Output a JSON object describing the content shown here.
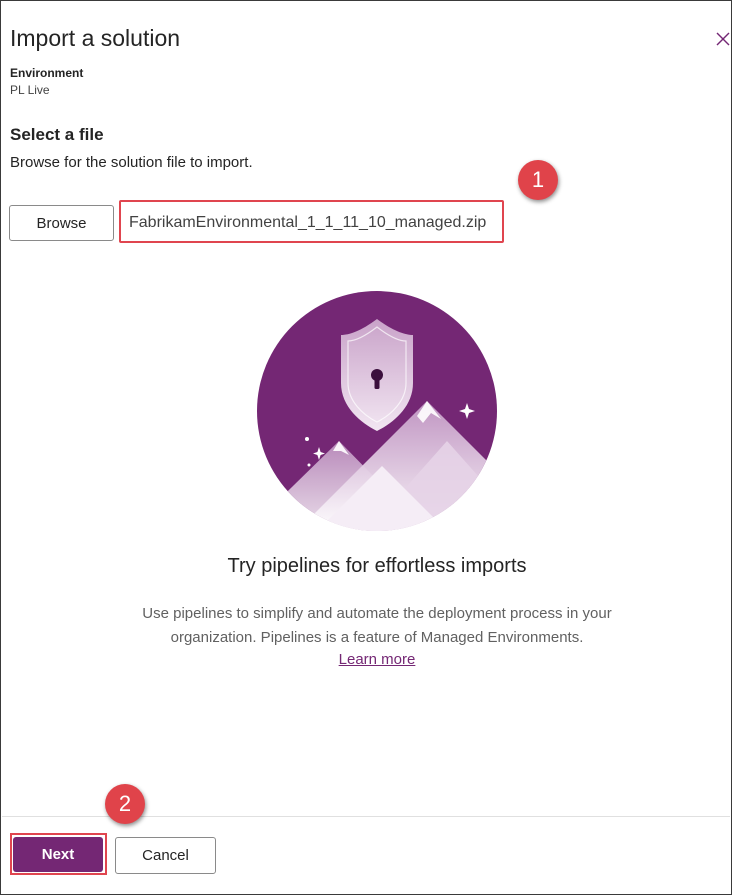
{
  "dialog": {
    "title": "Import a solution",
    "environment_label": "Environment",
    "environment_value": "PL Live"
  },
  "select_file": {
    "title": "Select a file",
    "description": "Browse for the solution file to import.",
    "browse_label": "Browse",
    "file_name": "FabrikamEnvironmental_1_1_11_10_managed.zip"
  },
  "promo": {
    "title": "Try pipelines for effortless imports",
    "text": "Use pipelines to simplify and automate the deployment process in your organization. Pipelines is a feature of Managed Environments.",
    "link": "Learn more",
    "icon": "shield-mountains-illustration"
  },
  "footer": {
    "next_label": "Next",
    "cancel_label": "Cancel"
  },
  "callouts": [
    "1",
    "2"
  ],
  "colors": {
    "accent": "#742774",
    "callout": "#e0434a",
    "highlight_border": "#e0454f"
  }
}
